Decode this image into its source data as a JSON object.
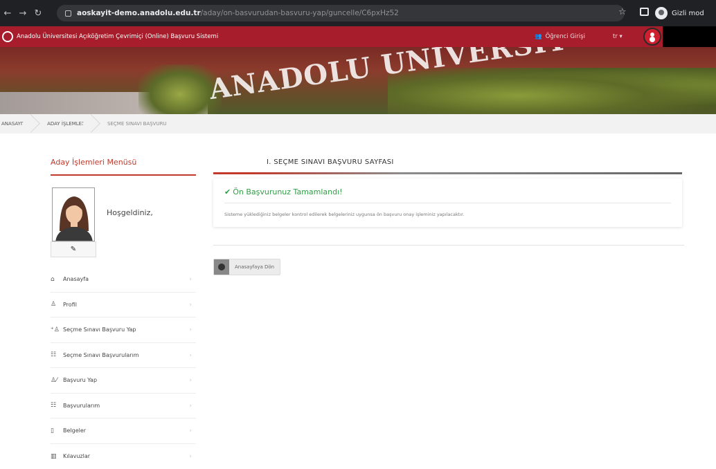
{
  "browser": {
    "url_host": "aoskayit-demo.anadolu.edu.tr",
    "url_path": "/aday/on-basvurudan-basvuru-yap/guncelle/C6pxHz52",
    "profile_label": "Gizli mod"
  },
  "header": {
    "site_title": "Anadolu Üniversitesi Açıköğretim Çevrimiçi (Online) Başvuru Sistemi",
    "student_login": "Öğrenci Girişi",
    "language": "tr ▾"
  },
  "banner": {
    "text": "ANADOLU UNIVERSIT"
  },
  "breadcrumb": [
    "ANASAYFA",
    "ADAY İŞLEMLERİ",
    "SEÇME SINAVI BAŞVURU"
  ],
  "sidebar": {
    "title": "Aday İşlemleri Menüsü",
    "welcome": "Hoşgeldiniz,",
    "items": [
      {
        "label": "Anasayfa",
        "icon": "home-icon",
        "glyph": "⌂"
      },
      {
        "label": "Profil",
        "icon": "user-icon",
        "glyph": "♙"
      },
      {
        "label": "Seçme Sınavı Başvuru Yap",
        "icon": "user-plus-icon",
        "glyph": "⁺♙"
      },
      {
        "label": "Seçme Sınavı Başvurularım",
        "icon": "list-icon",
        "glyph": "☷"
      },
      {
        "label": "Başvuru Yap",
        "icon": "user-edit-icon",
        "glyph": "♙⁄"
      },
      {
        "label": "Başvurularım",
        "icon": "list-icon",
        "glyph": "☷"
      },
      {
        "label": "Belgeler",
        "icon": "document-icon",
        "glyph": "▯"
      },
      {
        "label": "Kılavuzlar",
        "icon": "book-icon",
        "glyph": "▥"
      }
    ]
  },
  "main": {
    "heading": "I. SEÇME SINAVI BAŞVURU SAYFASI",
    "alert_title": "Ön Başvurunuz Tamamlandı!",
    "alert_text": "Sisteme yüklediğiniz belgeler kontrol edilerek belgeleriniz uygunsa ön başvuru onay işleminiz yapılacaktır.",
    "back_button": "Anasayfaya Dön"
  },
  "colors": {
    "brand_red": "#a81d2b",
    "success_green": "#2e9d43"
  }
}
